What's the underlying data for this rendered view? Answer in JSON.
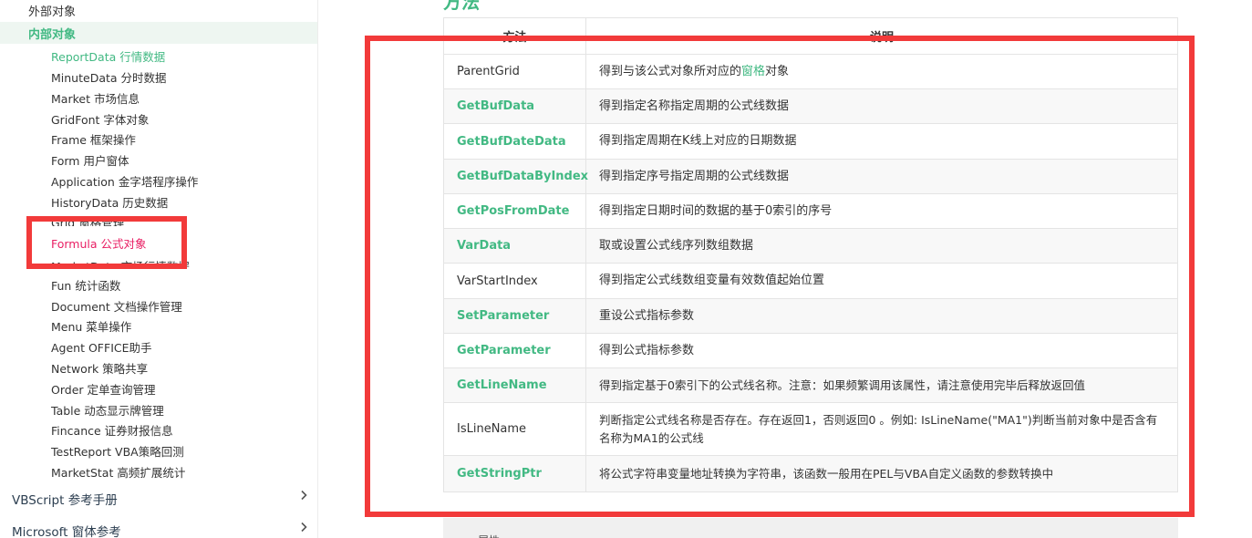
{
  "sidebar": {
    "top_items": [
      {
        "label": "外部对象"
      },
      {
        "label": "内部对象"
      }
    ],
    "sub_items": [
      {
        "label": "ReportData 行情数据"
      },
      {
        "label": "MinuteData 分时数据"
      },
      {
        "label": "Market 市场信息"
      },
      {
        "label": "GridFont 字体对象"
      },
      {
        "label": "Frame 框架操作"
      },
      {
        "label": "Form 用户窗体"
      },
      {
        "label": "Application 金字塔程序操作"
      },
      {
        "label": "HistoryData 历史数据"
      },
      {
        "label": "Grid 窗格管理"
      },
      {
        "label": "Formula 公式对象"
      },
      {
        "label": "MarketData 市场行情数据"
      },
      {
        "label": "Fun 统计函数"
      },
      {
        "label": "Document 文档操作管理"
      },
      {
        "label": "Menu 菜单操作"
      },
      {
        "label": "Agent OFFICE助手"
      },
      {
        "label": "Network 策略共享"
      },
      {
        "label": "Order 定单查询管理"
      },
      {
        "label": "Table 动态显示牌管理"
      },
      {
        "label": "Fincance 证券财报信息"
      },
      {
        "label": "TestReport VBA策略回测"
      },
      {
        "label": "MarketStat 高频扩展统计"
      }
    ],
    "sections": [
      {
        "label": "VBScript 参考手册"
      },
      {
        "label": "Microsoft 窗体参考"
      }
    ]
  },
  "main": {
    "heading": "方法",
    "table": {
      "headers": [
        "方法",
        "说明"
      ],
      "rows": [
        {
          "name": "ParentGrid",
          "desc_pre": "得到与该公式对象所对应的",
          "desc_link": "窗格",
          "desc_post": "对象"
        },
        {
          "name": "GetBufData",
          "desc": "得到指定名称指定周期的公式线数据"
        },
        {
          "name": "GetBufDateData",
          "desc": "得到指定周期在K线上对应的日期数据"
        },
        {
          "name": "GetBufDataByIndex",
          "desc": "得到指定序号指定周期的公式线数据"
        },
        {
          "name": "GetPosFromDate",
          "desc": "得到指定日期时间的数据的基于0索引的序号"
        },
        {
          "name": "VarData",
          "desc": "取或设置公式线序列数组数据"
        },
        {
          "name": "VarStartIndex",
          "desc": "得到指定公式线数组变量有效数值起始位置"
        },
        {
          "name": "SetParameter",
          "desc": "重设公式指标参数"
        },
        {
          "name": "GetParameter",
          "desc": "得到公式指标参数"
        },
        {
          "name": "GetLineName",
          "desc": "得到指定基于0索引下的公式线名称。注意：如果频繁调用该属性，请注意使用完毕后释放返回值"
        },
        {
          "name": "IsLineName",
          "desc": "判断指定公式线名称是否存在。存在返回1，否则返回0 。例如: IsLineName(\"MA1\")判断当前对象中是否含有名称为MA1的公式线"
        },
        {
          "name": "GetStringPtr",
          "desc": "将公式字符串变量地址转换为字符串，该函数一般用在PEL与VBA自定义函数的参数转换中"
        }
      ]
    },
    "bottom_fragment": "属性"
  },
  "colors": {
    "accent": "#42b983",
    "highlight": "#e91e63",
    "annotation": "#f23a3a"
  }
}
